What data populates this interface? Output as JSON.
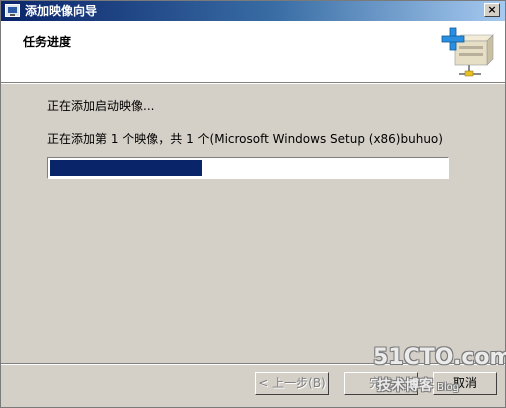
{
  "window": {
    "title": "添加映像向导",
    "close_glyph": "×"
  },
  "header": {
    "title": "任务进度",
    "graphic_icon": "server-add-icon"
  },
  "status": {
    "line1": "正在添加启动映像...",
    "line2": "正在添加第 1 个映像，共 1 个(Microsoft Windows Setup (x86)buhuo)"
  },
  "progress": {
    "fraction": 0.385
  },
  "buttons": {
    "back": "< 上一步(B)",
    "finish": "完成",
    "cancel": "取消"
  },
  "watermark": {
    "main": "51CTO.com",
    "sub": "技术博客",
    "blog": "Blog"
  },
  "colors": {
    "progress_fill": "#0a246a",
    "dialog_face": "#d4d0c8",
    "titlebar_start": "#0a246a",
    "titlebar_end": "#a6caf0"
  }
}
